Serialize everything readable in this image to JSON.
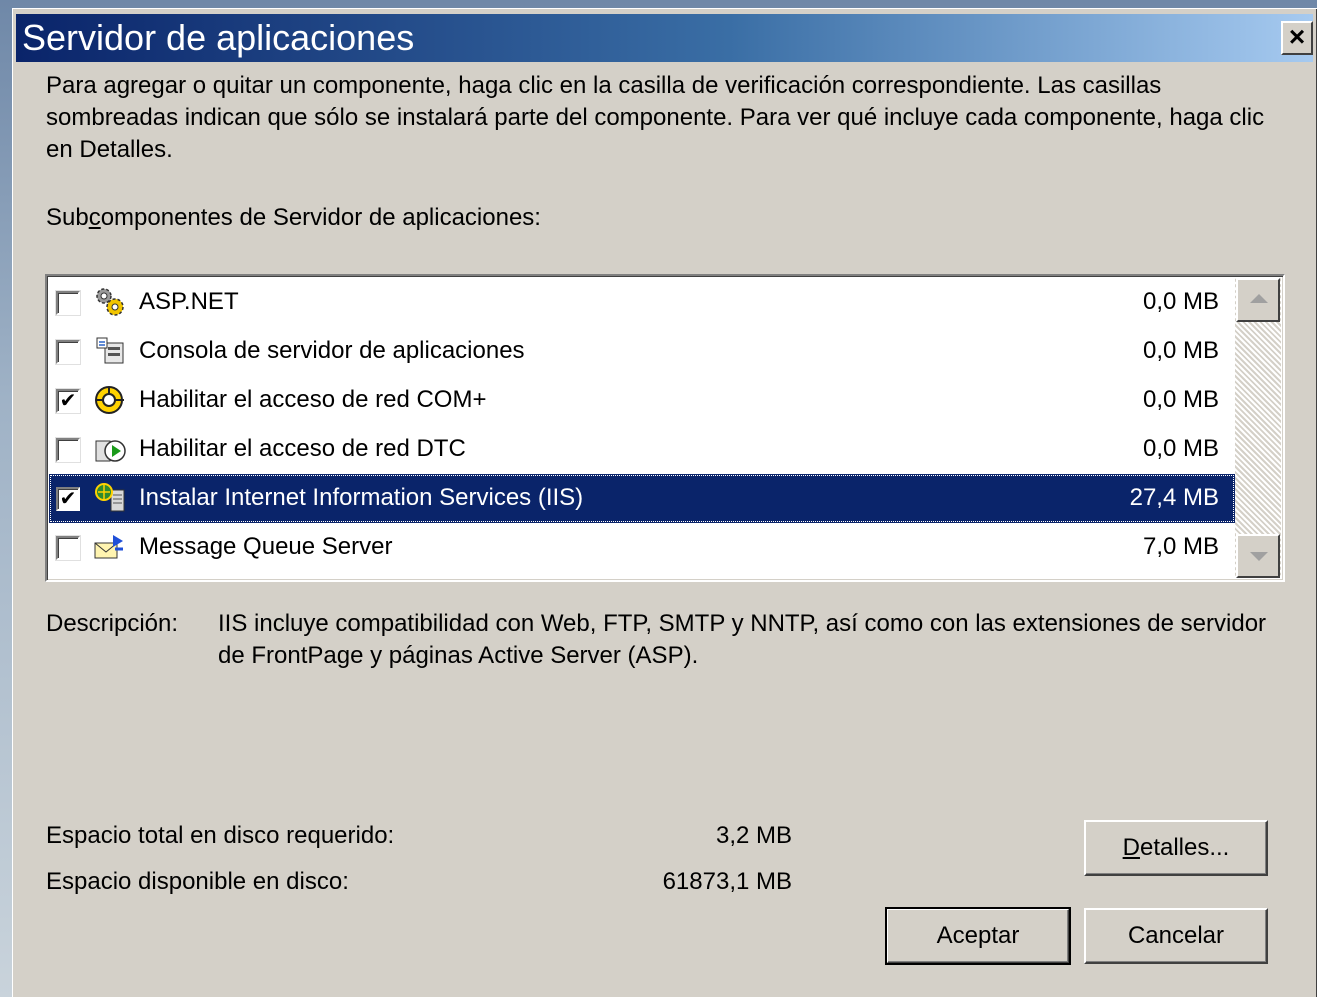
{
  "dialog": {
    "title": "Servidor de aplicaciones",
    "close_glyph": "×",
    "intro": "Para agregar o quitar un componente, haga clic en la casilla de verificación correspondiente. Las casillas sombreadas indican que sólo se instalará parte del componente. Para ver qué incluye cada componente, haga clic en Detalles.",
    "sub_label_pre": "Sub",
    "sub_label_mnemonic": "c",
    "sub_label_post": "omponentes de Servidor de aplicaciones:"
  },
  "components": [
    {
      "name": "ASP.NET",
      "size": "0,0 MB",
      "checked": false,
      "selected": false,
      "icon": "gears-icon"
    },
    {
      "name": "Consola de servidor de aplicaciones",
      "size": "0,0 MB",
      "checked": false,
      "selected": false,
      "icon": "console-icon"
    },
    {
      "name": "Habilitar el acceso de red COM+",
      "size": "0,0 MB",
      "checked": true,
      "selected": false,
      "icon": "com-network-icon"
    },
    {
      "name": "Habilitar el acceso de red DTC",
      "size": "0,0 MB",
      "checked": false,
      "selected": false,
      "icon": "dtc-icon"
    },
    {
      "name": "Instalar Internet Information Services (IIS)",
      "size": "27,4 MB",
      "checked": true,
      "selected": true,
      "icon": "iis-icon"
    },
    {
      "name": "Message Queue Server",
      "size": "7,0 MB",
      "checked": false,
      "selected": false,
      "icon": "message-queue-icon"
    }
  ],
  "description": {
    "label": "Descripción:",
    "text": "IIS incluye compatibilidad con Web, FTP, SMTP y NNTP, así como con las extensiones de servidor de FrontPage y páginas Active Server (ASP)."
  },
  "disk": {
    "required_label": "Espacio total en disco requerido:",
    "required_value": "3,2 MB",
    "available_label": "Espacio disponible en disco:",
    "available_value": "61873,1 MB"
  },
  "buttons": {
    "details_mnemonic": "D",
    "details_rest": "etalles...",
    "accept": "Aceptar",
    "cancel": "Cancelar"
  },
  "check_glyph": "✔"
}
